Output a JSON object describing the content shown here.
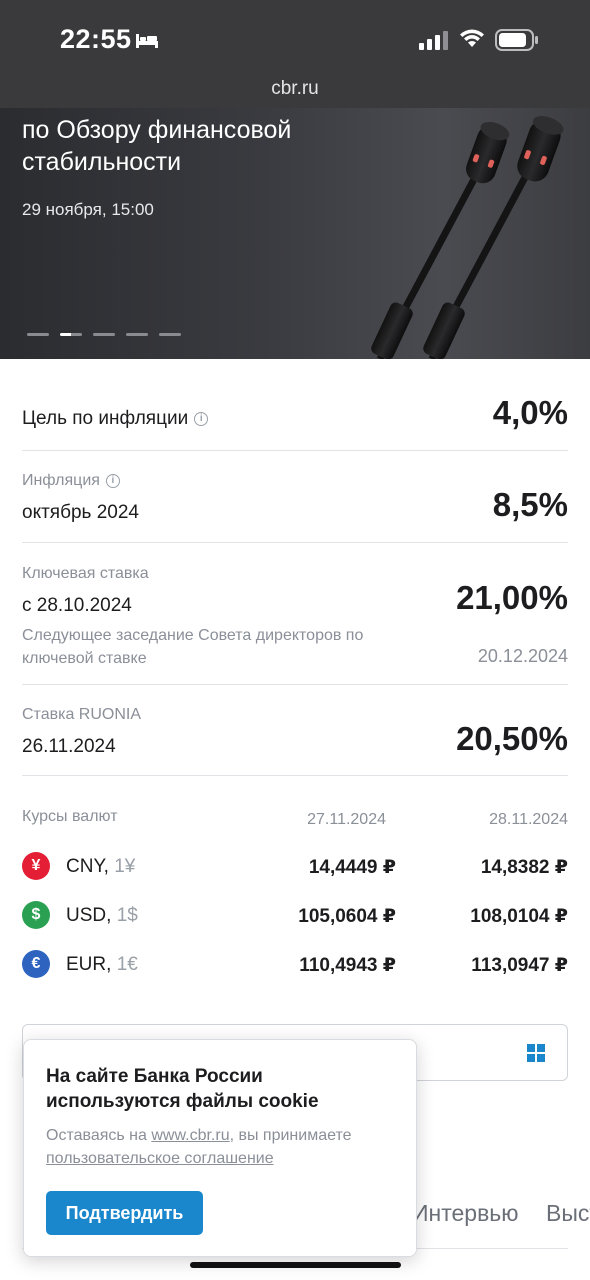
{
  "status_bar": {
    "time": "22:55"
  },
  "browser": {
    "url": "cbr.ru"
  },
  "hero": {
    "title_line1": "по Обзору финансовой",
    "title_line2": "стабильности",
    "date": "29 ноября, 15:00",
    "slides_total": 5,
    "active_slide": 2
  },
  "indicators": {
    "inflation_target": {
      "label": "Цель по инфляции",
      "value": "4,0%"
    },
    "inflation": {
      "label": "Инфляция",
      "period": "октябрь 2024",
      "value": "8,5%"
    },
    "key_rate": {
      "label": "Ключевая ставка",
      "since": "с 28.10.2024",
      "value": "21,00%",
      "next_meeting_label": "Следующее заседание Совета директоров по ключевой ставке",
      "next_meeting_date": "20.12.2024"
    },
    "ruonia": {
      "label": "Ставка RUONIA",
      "date": "26.11.2024",
      "value": "20,50%"
    }
  },
  "currency": {
    "header": "Курсы валют",
    "date1": "27.11.2024",
    "date2": "28.11.2024",
    "rows": [
      {
        "code": "CNY",
        "unit": "1¥",
        "icon": "¥",
        "color": "#e31e35",
        "v1": "14,4449 ₽",
        "v2": "14,8382 ₽"
      },
      {
        "code": "USD",
        "unit": "1$",
        "icon": "$",
        "color": "#2aa053",
        "v1": "105,0604 ₽",
        "v2": "108,0104 ₽"
      },
      {
        "code": "EUR",
        "unit": "1€",
        "icon": "€",
        "color": "#2f63c0",
        "v1": "110,4943 ₽",
        "v2": "113,0947 ₽"
      }
    ]
  },
  "tabs_behind": {
    "tab1": "Интервью",
    "tab2": "Выст"
  },
  "cookie": {
    "title": "На сайте Банка России используются файлы cookie",
    "text_before": "Оставаясь на ",
    "link1": "www.cbr.ru",
    "text_after": ", вы принимаете ",
    "link2": "пользовательское соглашение",
    "button": "Подтвердить"
  }
}
